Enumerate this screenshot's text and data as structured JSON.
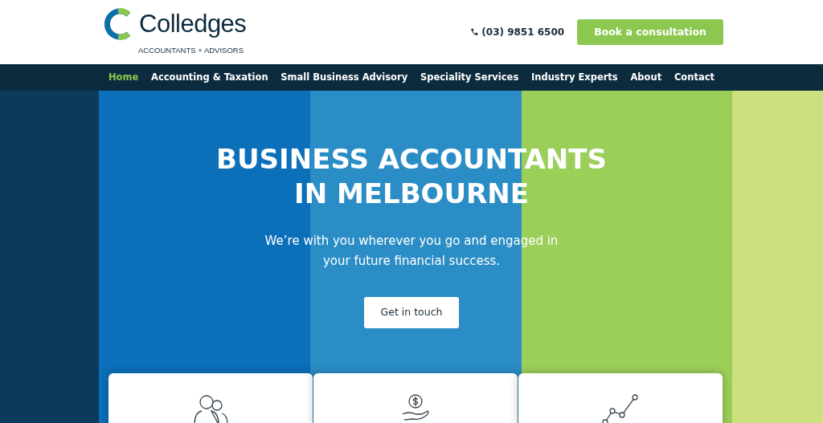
{
  "header": {
    "logo": {
      "name": "Colledges",
      "tagline": "ACCOUNTANTS + ADVISORS"
    },
    "phone": "(03) 9851 6500",
    "cta": "Book a consultation"
  },
  "nav": [
    {
      "label": "Home",
      "selected": true
    },
    {
      "label": "Accounting & Taxation",
      "selected": false
    },
    {
      "label": "Small Business Advisory",
      "selected": false
    },
    {
      "label": "Speciality Services",
      "selected": false
    },
    {
      "label": "Industry Experts",
      "selected": false
    },
    {
      "label": "About",
      "selected": false
    },
    {
      "label": "Contact",
      "selected": false
    }
  ],
  "hero": {
    "title_lines": [
      "BUSINESS ACCOUNTANTS",
      "IN MELBOURNE"
    ],
    "subtitle_lines": [
      "We’re with you wherever you go and engaged in",
      "your future financial success."
    ],
    "button": "Get in touch"
  },
  "cards": [
    {
      "kind": "people"
    },
    {
      "kind": "coin"
    },
    {
      "kind": "growth"
    }
  ]
}
